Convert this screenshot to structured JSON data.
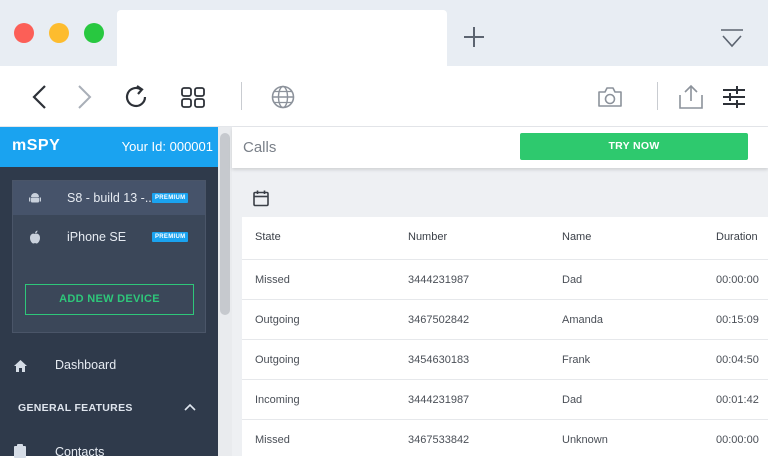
{
  "browser": {
    "new_tab_symbol": "+",
    "menu_icon": "menu-chevron-icon"
  },
  "sidebar": {
    "logo": "mSPY",
    "user_id": "Your Id: 000001",
    "devices": [
      {
        "name": "S8 - build 13 -...",
        "badge": "PREMIUM",
        "icon": "android-icon"
      },
      {
        "name": "iPhone SE",
        "badge": "PREMIUM",
        "icon": "apple-icon"
      }
    ],
    "add_device": "ADD NEW DEVICE",
    "nav": {
      "dashboard": "Dashboard",
      "section": "GENERAL FEATURES",
      "contacts": "Contacts"
    }
  },
  "main": {
    "title": "Calls",
    "try_now": "TRY NOW",
    "columns": [
      "State",
      "Number",
      "Name",
      "Duration"
    ],
    "rows": [
      [
        "Missed",
        "3444231987",
        "Dad",
        "00:00:00"
      ],
      [
        "Outgoing",
        "3467502842",
        "Amanda",
        "00:15:09"
      ],
      [
        "Outgoing",
        "3454630183",
        "Frank",
        "00:04:50"
      ],
      [
        "Incoming",
        "3444231987",
        "Dad",
        "00:01:42"
      ],
      [
        "Missed",
        "3467533842",
        "Unknown",
        "00:00:00"
      ]
    ]
  },
  "colors": {
    "brand": "#1aa3f0",
    "accent_green": "#2ec96e",
    "sidebar_bg": "#2f3a4b"
  }
}
